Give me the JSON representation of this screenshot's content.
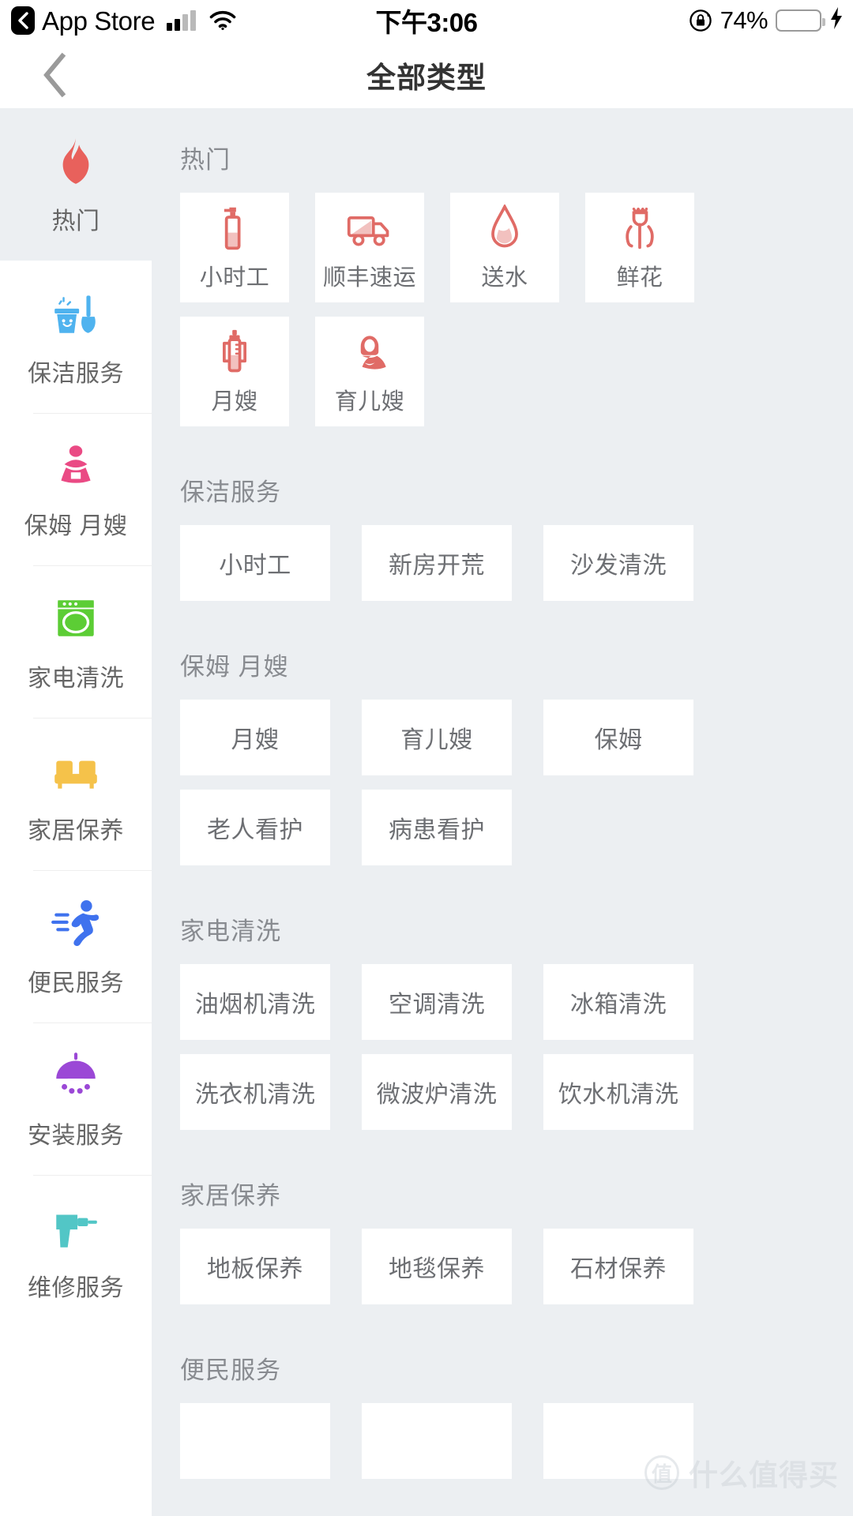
{
  "status_bar": {
    "back_app": "App Store",
    "time": "下午3:06",
    "battery_percent": "74%",
    "battery_level": 74,
    "icons": [
      "back-chevron-icon",
      "signal-bars-icon",
      "wifi-icon",
      "rotation-lock-icon",
      "battery-icon",
      "charging-bolt-icon"
    ]
  },
  "navbar": {
    "title": "全部类型",
    "back_icon": "chevron-left-icon"
  },
  "sidebar": {
    "items": [
      {
        "label": "热门",
        "icon": "flame-icon",
        "color": "#e8615c",
        "active": true
      },
      {
        "label": "保洁服务",
        "icon": "bucket-broom-icon",
        "color": "#4fb3ef",
        "active": false
      },
      {
        "label": "保姆 月嫂",
        "icon": "nanny-icon",
        "color": "#ea4a84",
        "active": false
      },
      {
        "label": "家电清洗",
        "icon": "washing-machine-icon",
        "color": "#5ccd35",
        "active": false
      },
      {
        "label": "家居保养",
        "icon": "sofa-icon",
        "color": "#f5c24a",
        "active": false
      },
      {
        "label": "便民服务",
        "icon": "runner-icon",
        "color": "#3f72ee",
        "active": false
      },
      {
        "label": "安装服务",
        "icon": "shower-lamp-icon",
        "color": "#9b48d6",
        "active": false
      },
      {
        "label": "维修服务",
        "icon": "drill-icon",
        "color": "#52c6c6",
        "active": false
      }
    ]
  },
  "content": {
    "accent_color": "#e06b66",
    "card_bg": "#ffffff",
    "page_bg": "#eceff2",
    "sections": [
      {
        "title": "热门",
        "layout": "hot",
        "items": [
          {
            "label": "小时工",
            "icon": "spray-bottle-icon"
          },
          {
            "label": "顺丰速运",
            "icon": "truck-icon"
          },
          {
            "label": "送水",
            "icon": "water-drop-icon"
          },
          {
            "label": "鲜花",
            "icon": "flower-icon"
          },
          {
            "label": "月嫂",
            "icon": "baby-bottle-icon"
          },
          {
            "label": "育儿嫂",
            "icon": "nurse-person-icon"
          }
        ]
      },
      {
        "title": "保洁服务",
        "layout": "text",
        "items": [
          {
            "label": "小时工"
          },
          {
            "label": "新房开荒"
          },
          {
            "label": "沙发清洗"
          }
        ]
      },
      {
        "title": "保姆 月嫂",
        "layout": "text",
        "items": [
          {
            "label": "月嫂"
          },
          {
            "label": "育儿嫂"
          },
          {
            "label": "保姆"
          },
          {
            "label": "老人看护"
          },
          {
            "label": "病患看护"
          }
        ]
      },
      {
        "title": "家电清洗",
        "layout": "text",
        "items": [
          {
            "label": "油烟机清洗"
          },
          {
            "label": "空调清洗"
          },
          {
            "label": "冰箱清洗"
          },
          {
            "label": "洗衣机清洗"
          },
          {
            "label": "微波炉清洗"
          },
          {
            "label": "饮水机清洗"
          }
        ]
      },
      {
        "title": "家居保养",
        "layout": "text",
        "items": [
          {
            "label": "地板保养"
          },
          {
            "label": "地毯保养"
          },
          {
            "label": "石材保养"
          }
        ]
      },
      {
        "title": "便民服务",
        "layout": "text",
        "items": [
          {
            "label": ""
          },
          {
            "label": ""
          },
          {
            "label": ""
          }
        ]
      }
    ]
  },
  "watermark": {
    "logo": "值",
    "text": "什么值得买"
  }
}
